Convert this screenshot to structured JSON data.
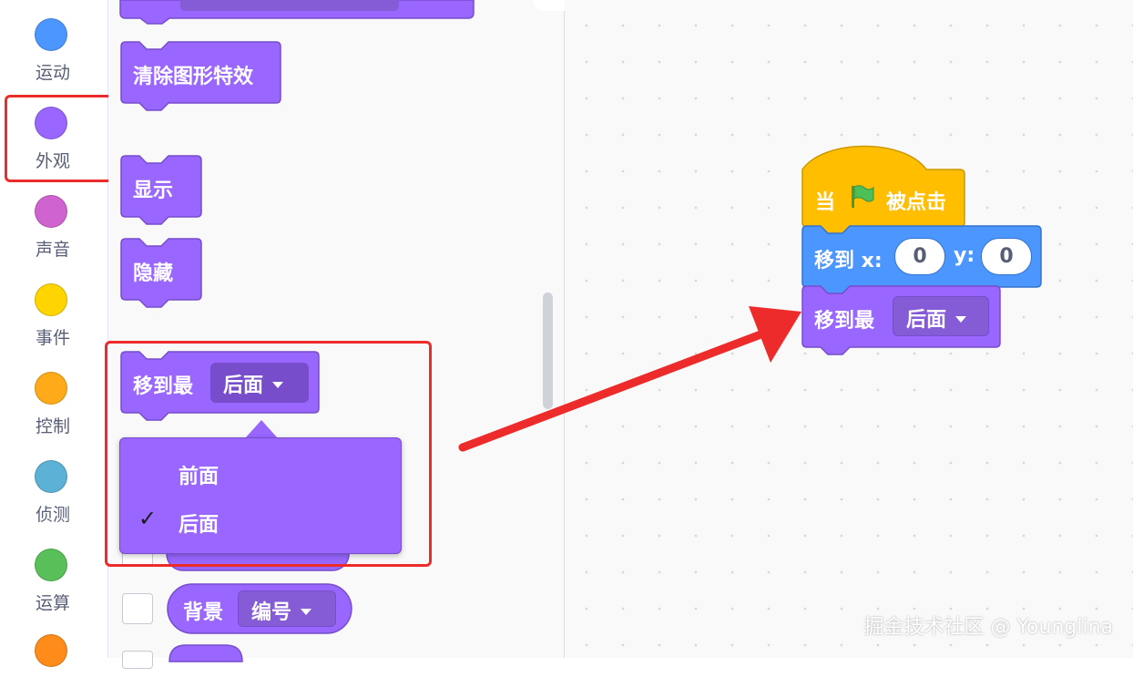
{
  "categories": [
    {
      "label": "运动",
      "color": "#4c97ff"
    },
    {
      "label": "外观",
      "color": "#9966ff"
    },
    {
      "label": "声音",
      "color": "#cf63cf"
    },
    {
      "label": "事件",
      "color": "#ffd500"
    },
    {
      "label": "控制",
      "color": "#ffab19"
    },
    {
      "label": "侦测",
      "color": "#5cb1d6"
    },
    {
      "label": "运算",
      "color": "#59c059"
    },
    {
      "label": "",
      "color": "#ff8c1a"
    }
  ],
  "selected_category": "外观",
  "palette": {
    "clear_effects": "清除图形特效",
    "show": "显示",
    "hide": "隐藏",
    "go_to_layer": {
      "label": "移到最",
      "value": "后面"
    },
    "menu_options": [
      {
        "label": "前面",
        "checked": false
      },
      {
        "label": "后面",
        "checked": true
      }
    ],
    "check_symbol": "✓",
    "backdrop_reporter": {
      "label": "背景",
      "value": "编号"
    }
  },
  "workspace": {
    "hat": {
      "prefix": "当",
      "suffix": "被点击",
      "flag_icon": "green-flag-icon"
    },
    "goto": {
      "label": "移到 x:",
      "x_value": "0",
      "y_label": "y:",
      "y_value": "0"
    },
    "layer": {
      "label": "移到最",
      "value": "后面"
    }
  },
  "watermark": "掘金技术社区 @ Younglina",
  "colors": {
    "looks": "#9966ff",
    "looks_dark": "#774dcb",
    "motion": "#4c97ff",
    "events": "#ffbf00",
    "annotation": "#ee2b2b"
  }
}
